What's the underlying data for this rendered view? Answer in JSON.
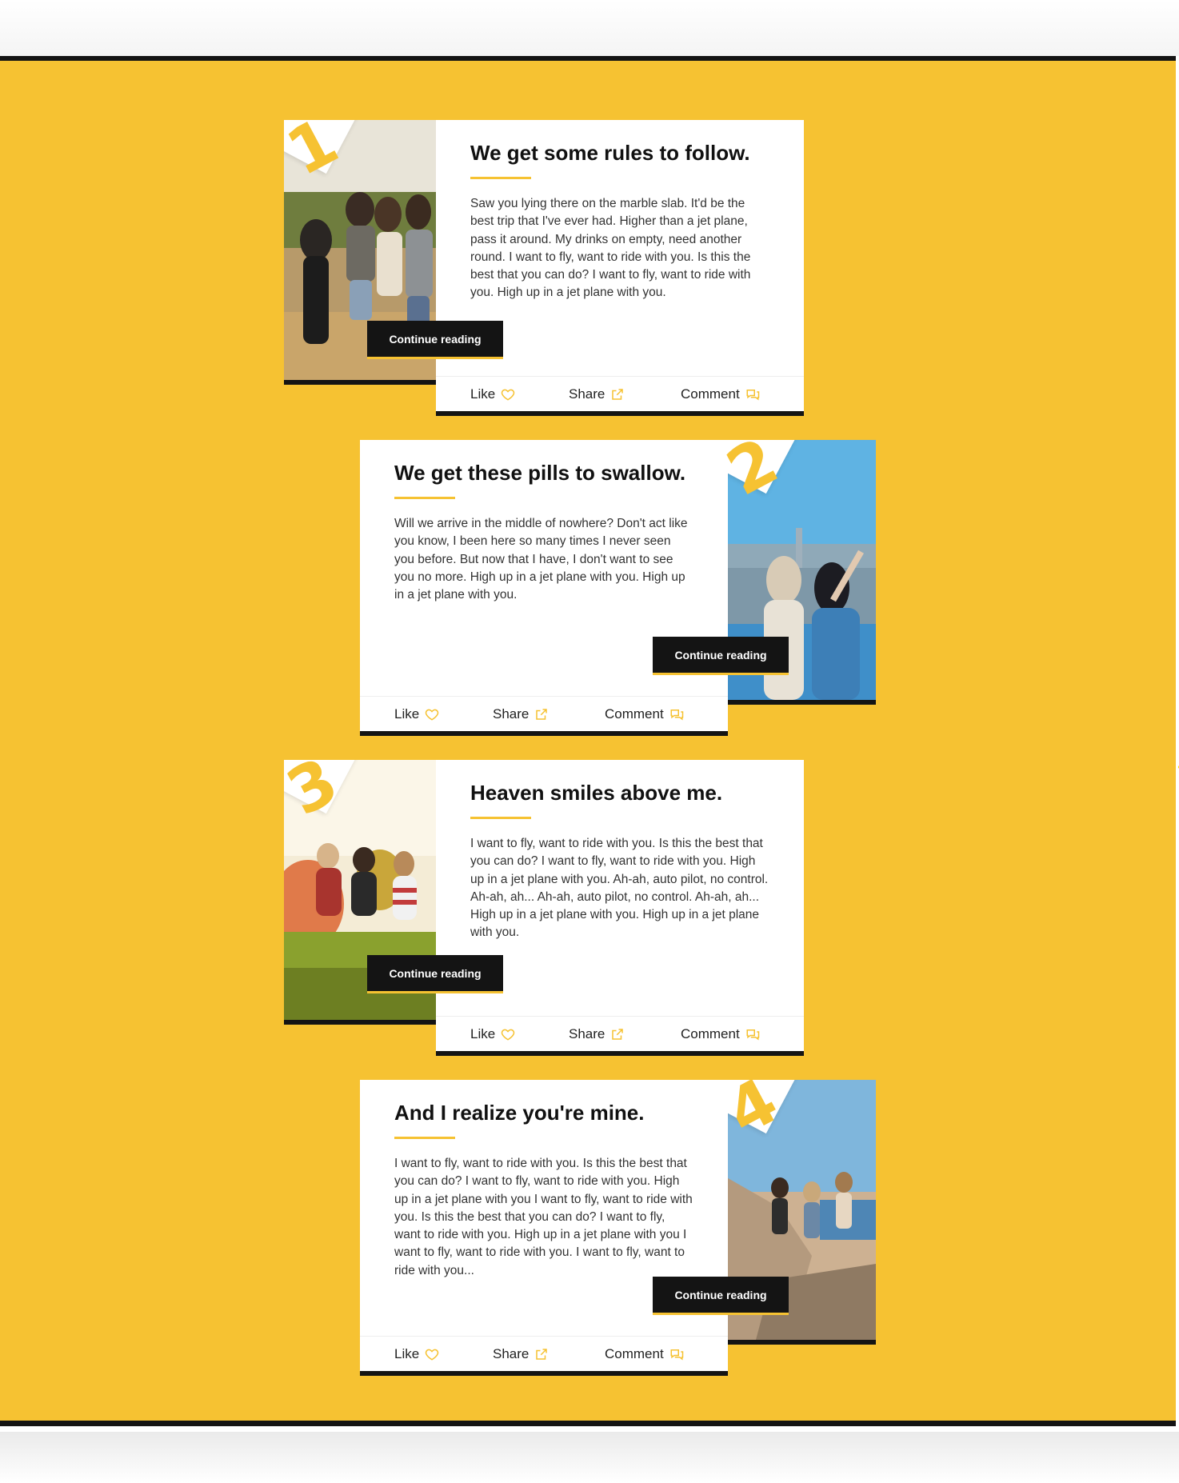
{
  "posts": [
    {
      "number": "1",
      "title": "We get some rules to follow.",
      "excerpt": "Saw you lying there on the marble slab. It'd be the best trip that I've ever had. Higher than a jet plane, pass it around. My drinks on empty, need another round. I want to fly, want to ride with you. Is this the best that you can do? I want to fly, want to ride with you. High up in a jet plane with you.",
      "button_label": "Continue reading",
      "like_label": "Like",
      "share_label": "Share",
      "comment_label": "Comment",
      "image_alt": "four friends standing outdoors in a field"
    },
    {
      "number": "2",
      "title": "We get these pills to swallow.",
      "excerpt": "Will we arrive in the middle of nowhere? Don't act like you know, I been here so many times I never seen you before. But now that I have, I don't want to see you no more. High up in a jet plane with you. High up in a jet plane with you.",
      "button_label": "Continue reading",
      "like_label": "Like",
      "share_label": "Share",
      "comment_label": "Comment",
      "image_alt": "two women on a rooftop overlooking a city skyline"
    },
    {
      "number": "3",
      "title": "Heaven smiles above me.",
      "excerpt": "I want to fly, want to ride with you. Is this the best that you can do? I want to fly, want to ride with you. High up in a jet plane with you. Ah-ah, auto pilot, no control. Ah-ah, ah... Ah-ah, auto pilot, no control. Ah-ah, ah... High up in a jet plane with you. High up in a jet plane with you.",
      "button_label": "Continue reading",
      "like_label": "Like",
      "share_label": "Share",
      "comment_label": "Comment",
      "image_alt": "friends jumping in a meadow with hot air balloons"
    },
    {
      "number": "4",
      "title": "And I realize you're mine.",
      "excerpt": "I want to fly, want to ride with you. Is this the best that you can do? I want to fly, want to ride with you. High up in a jet plane with you I want to fly, want to ride with you. Is this the best that you can do? I want to fly, want to ride with you. High up in a jet plane with you I want to fly, want to ride with you. I want to fly, want to ride with you...",
      "button_label": "Continue reading",
      "like_label": "Like",
      "share_label": "Share",
      "comment_label": "Comment",
      "image_alt": "friends jumping on a rocky beach"
    }
  ],
  "colors": {
    "accent": "#f6c232",
    "dark": "#141414",
    "card": "#ffffff"
  },
  "icons": {
    "like": "heart-icon",
    "share": "share-arrow-icon",
    "comment": "chat-bubble-icon"
  }
}
